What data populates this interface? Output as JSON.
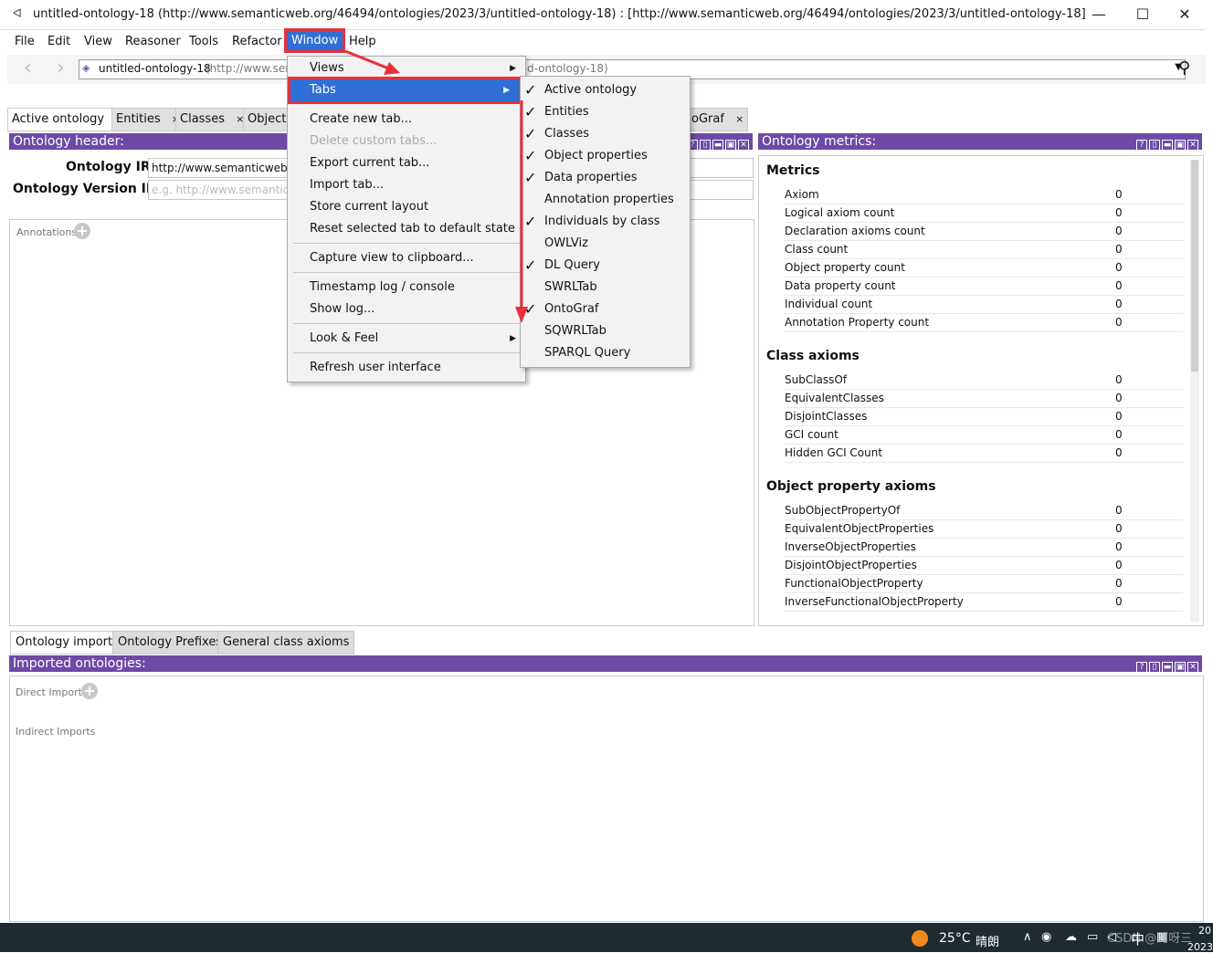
{
  "window": {
    "title": "untitled-ontology-18 (http://www.semanticweb.org/46494/ontologies/2023/3/untitled-ontology-18)  : [http://www.semanticweb.org/46494/ontologies/2023/3/untitled-ontology-18]",
    "minimize": "—",
    "maximize": "☐",
    "close": "✕"
  },
  "menubar": [
    "File",
    "Edit",
    "View",
    "Reasoner",
    "Tools",
    "Refactor",
    "Window",
    "Help"
  ],
  "nav": {
    "back": "‹",
    "forward": "›",
    "ontology_name": "untitled-ontology-18",
    "ontology_iri_partial": "(http://www.ser",
    "ontology_iri_tail": "d-ontology-18)"
  },
  "tabs": [
    {
      "label": "Active ontology",
      "close": "×"
    },
    {
      "label": "Entities",
      "close": "×"
    },
    {
      "label": "Classes",
      "close": "×"
    },
    {
      "label": "Object",
      "close": ""
    },
    {
      "label": "oGraf",
      "close": "×"
    }
  ],
  "ontology_header": {
    "title": "Ontology header:",
    "iri_label": "Ontology IRI",
    "iri_value": "http://www.semanticweb.or",
    "version_label": "Ontology Version IRI",
    "version_placeholder": "e.g. http://www.semanticwe",
    "annotations_label": "Annotations"
  },
  "metrics": {
    "title": "Ontology metrics:",
    "sections": [
      {
        "heading": "Metrics",
        "rows": [
          {
            "k": "Axiom",
            "v": "0"
          },
          {
            "k": "Logical axiom count",
            "v": "0"
          },
          {
            "k": "Declaration axioms count",
            "v": "0"
          },
          {
            "k": "Class count",
            "v": "0"
          },
          {
            "k": "Object property count",
            "v": "0"
          },
          {
            "k": "Data property count",
            "v": "0"
          },
          {
            "k": "Individual count",
            "v": "0"
          },
          {
            "k": "Annotation Property count",
            "v": "0"
          }
        ]
      },
      {
        "heading": "Class axioms",
        "rows": [
          {
            "k": "SubClassOf",
            "v": "0"
          },
          {
            "k": "EquivalentClasses",
            "v": "0"
          },
          {
            "k": "DisjointClasses",
            "v": "0"
          },
          {
            "k": "GCI count",
            "v": "0"
          },
          {
            "k": "Hidden GCI Count",
            "v": "0"
          }
        ]
      },
      {
        "heading": "Object property axioms",
        "rows": [
          {
            "k": "SubObjectPropertyOf",
            "v": "0"
          },
          {
            "k": "EquivalentObjectProperties",
            "v": "0"
          },
          {
            "k": "InverseObjectProperties",
            "v": "0"
          },
          {
            "k": "DisjointObjectProperties",
            "v": "0"
          },
          {
            "k": "FunctionalObjectProperty",
            "v": "0"
          },
          {
            "k": "InverseFunctionalObjectProperty",
            "v": "0"
          }
        ]
      }
    ]
  },
  "bottom_tabs": [
    "Ontology imports",
    "Ontology Prefixes",
    "General class axioms"
  ],
  "imports": {
    "title": "Imported ontologies:",
    "direct": "Direct Imports",
    "indirect": "Indirect Imports"
  },
  "window_menu": [
    {
      "label": "Views",
      "submenu": true
    },
    {
      "label": "Tabs",
      "submenu": true
    },
    {
      "label": "Create new tab..."
    },
    {
      "label": "Delete custom tabs...",
      "disabled": true
    },
    {
      "label": "Export current tab..."
    },
    {
      "label": "Import tab..."
    },
    {
      "label": "Store current layout"
    },
    {
      "label": "Reset selected tab to default state"
    },
    {
      "label": "Capture view to clipboard..."
    },
    {
      "label": "Timestamp log / console"
    },
    {
      "label": "Show log..."
    },
    {
      "label": "Look & Feel",
      "submenu": true
    },
    {
      "label": "Refresh user interface"
    }
  ],
  "tabs_menu": [
    {
      "label": "Active ontology",
      "checked": true
    },
    {
      "label": "Entities",
      "checked": true
    },
    {
      "label": "Classes",
      "checked": true
    },
    {
      "label": "Object properties",
      "checked": true
    },
    {
      "label": "Data properties",
      "checked": true
    },
    {
      "label": "Annotation properties",
      "checked": false
    },
    {
      "label": "Individuals by class",
      "checked": true
    },
    {
      "label": "OWLViz",
      "checked": false
    },
    {
      "label": "DL Query",
      "checked": true
    },
    {
      "label": "SWRLTab",
      "checked": false
    },
    {
      "label": "OntoGraf",
      "checked": true
    },
    {
      "label": "SQWRLTab",
      "checked": false
    },
    {
      "label": "SPARQL Query",
      "checked": false
    }
  ],
  "taskbar": {
    "temp": "25°C",
    "weather": "晴朗",
    "ime": "中",
    "watermark": "CSDN @阿呀三",
    "time_partial": "20",
    "date_partial": "2023"
  },
  "colors": {
    "accent": "#6d4aa6",
    "highlight": "#2f6fd6",
    "annotation": "#e8303a"
  }
}
